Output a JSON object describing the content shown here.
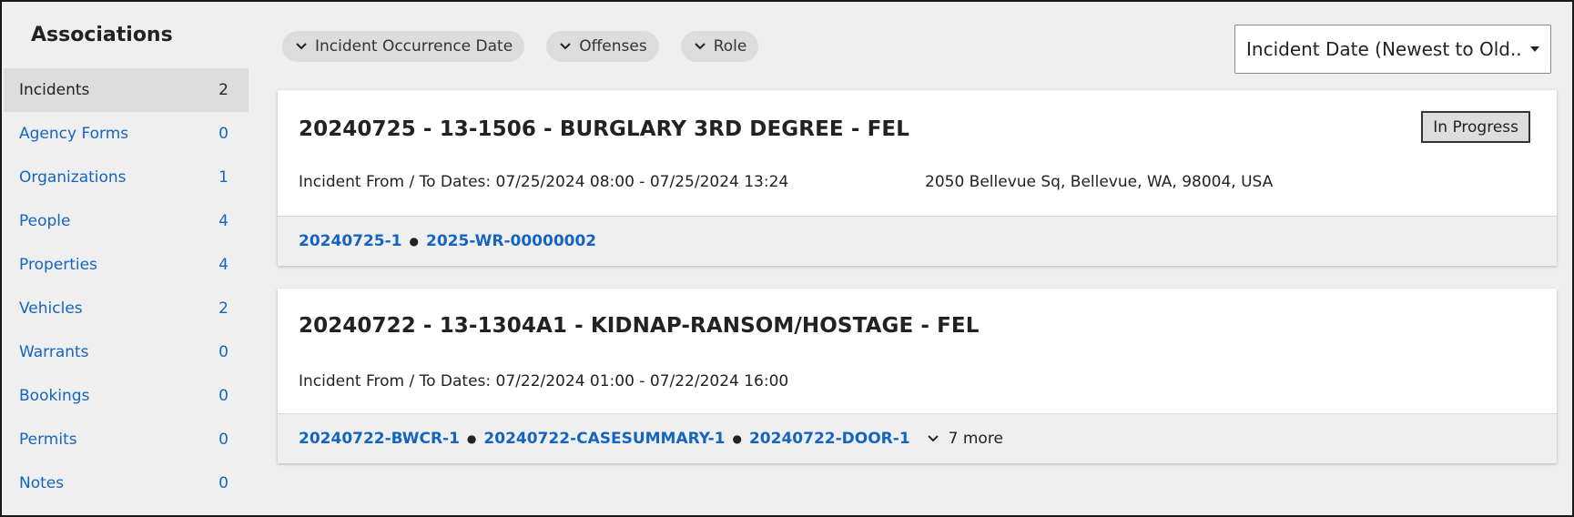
{
  "sidebar": {
    "title": "Associations",
    "items": [
      {
        "label": "Incidents",
        "count": "2"
      },
      {
        "label": "Agency Forms",
        "count": "0"
      },
      {
        "label": "Organizations",
        "count": "1"
      },
      {
        "label": "People",
        "count": "4"
      },
      {
        "label": "Properties",
        "count": "4"
      },
      {
        "label": "Vehicles",
        "count": "2"
      },
      {
        "label": "Warrants",
        "count": "0"
      },
      {
        "label": "Bookings",
        "count": "0"
      },
      {
        "label": "Permits",
        "count": "0"
      },
      {
        "label": "Notes",
        "count": "0"
      }
    ]
  },
  "filters": [
    {
      "label": "Incident Occurrence Date",
      "icon": "chevron-down-icon"
    },
    {
      "label": "Offenses",
      "icon": "chevron-down-icon"
    },
    {
      "label": "Role",
      "icon": "chevron-down-icon"
    }
  ],
  "sort": {
    "selected": "Incident Date (Newest to Old..."
  },
  "incidents": [
    {
      "title": "20240725 - 13-1506 - BURGLARY 3RD DEGREE - FEL",
      "status": "In Progress",
      "dates": "Incident From / To Dates: 07/25/2024 08:00 - 07/25/2024 13:24",
      "address": "2050 Bellevue Sq, Bellevue, WA, 98004, USA",
      "links": [
        "20240725-1",
        "2025-WR-00000002"
      ]
    },
    {
      "title": "20240722 - 13-1304A1 - KIDNAP-RANSOM/HOSTAGE - FEL",
      "dates": "Incident From / To Dates: 07/22/2024 01:00 - 07/22/2024 16:00",
      "links": [
        "20240722-BWCR-1",
        "20240722-CASESUMMARY-1",
        "20240722-DOOR-1"
      ],
      "more": "7 more"
    }
  ],
  "colors": {
    "link": "#1565c0",
    "background": "#efefef",
    "active_item": "#dcdcdc"
  }
}
